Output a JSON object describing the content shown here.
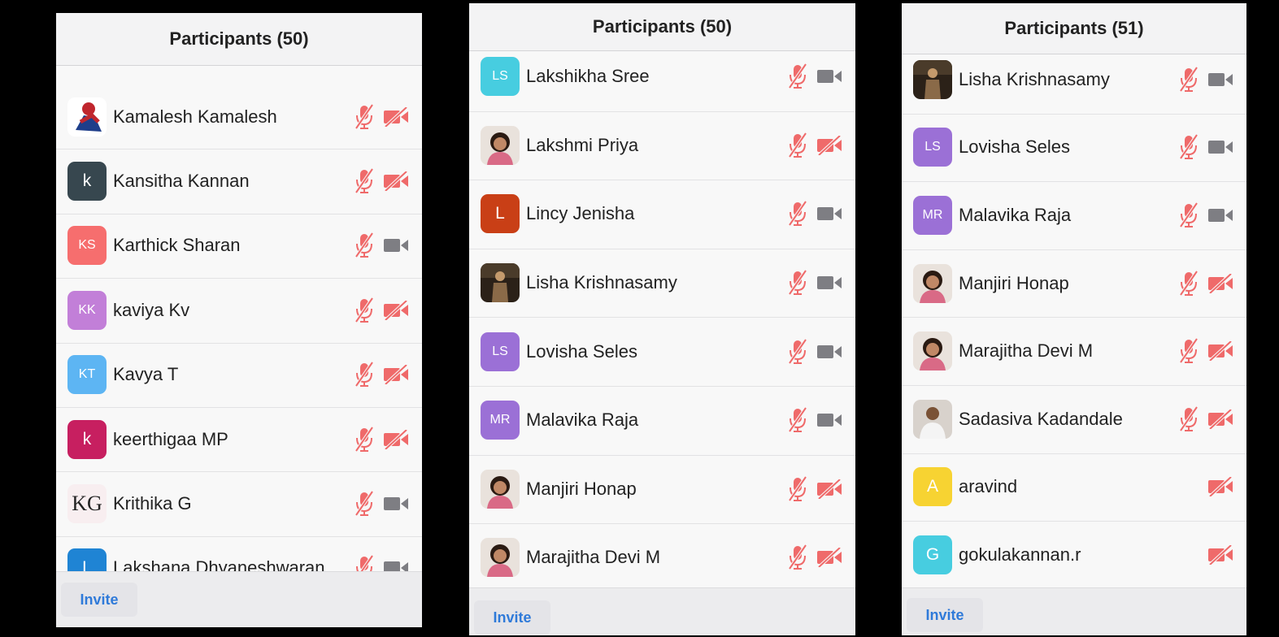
{
  "colors": {
    "muted": "#ef6a6a",
    "video_on": "#7e7e83",
    "link": "#2f7ad9"
  },
  "panels": [
    {
      "title": "Participants (50)",
      "invite_label": "Invite",
      "participants": [
        {
          "name": "Kamalesh Kamalesh",
          "avatar_type": "photo",
          "avatar_icon": "spiderman-photo",
          "mic": "muted",
          "video": "off"
        },
        {
          "name": "Kansitha Kannan",
          "initials": "k",
          "avatar_color": "#37474f",
          "mic": "muted",
          "video": "off"
        },
        {
          "name": "Karthick Sharan",
          "initials": "KS",
          "avatar_color": "#f66e6e",
          "mic": "muted",
          "video": "on"
        },
        {
          "name": "kaviya Kv",
          "initials": "KK",
          "avatar_color": "#c27fd8",
          "mic": "muted",
          "video": "off"
        },
        {
          "name": "Kavya T",
          "initials": "KT",
          "avatar_color": "#5db5f3",
          "mic": "muted",
          "video": "off"
        },
        {
          "name": "keerthigaa MP",
          "initials": "k",
          "avatar_color": "#c71f60",
          "mic": "muted",
          "video": "off"
        },
        {
          "name": "Krithika G",
          "avatar_type": "logo",
          "logo_text": "KG",
          "mic": "muted",
          "video": "on"
        },
        {
          "name": "Lakshana Dhyaneshwaran",
          "initials": "L",
          "avatar_color": "#1f84d4",
          "mic": "muted",
          "video": "on"
        }
      ]
    },
    {
      "title": "Participants (50)",
      "invite_label": "Invite",
      "participants": [
        {
          "name": "Lakshikha Sree",
          "initials": "LS",
          "avatar_color": "#47cde0",
          "mic": "muted",
          "video": "on"
        },
        {
          "name": "Lakshmi Priya",
          "avatar_type": "photo",
          "avatar_icon": "woman-photo",
          "mic": "muted",
          "video": "off"
        },
        {
          "name": "Lincy Jenisha",
          "initials": "L",
          "avatar_color": "#c93f16",
          "mic": "muted",
          "video": "on"
        },
        {
          "name": "Lisha Krishnasamy",
          "avatar_type": "photo",
          "avatar_icon": "warrior-photo",
          "mic": "muted",
          "video": "on"
        },
        {
          "name": "Lovisha Seles",
          "initials": "LS",
          "avatar_color": "#9b70d6",
          "mic": "muted",
          "video": "on"
        },
        {
          "name": "Malavika Raja",
          "initials": "MR",
          "avatar_color": "#9b70d6",
          "mic": "muted",
          "video": "on"
        },
        {
          "name": "Manjiri Honap",
          "avatar_type": "photo",
          "avatar_icon": "woman-photo",
          "mic": "muted",
          "video": "off"
        },
        {
          "name": "Marajitha Devi M",
          "avatar_type": "photo",
          "avatar_icon": "woman-photo",
          "mic": "muted",
          "video": "off"
        }
      ]
    },
    {
      "title": "Participants (51)",
      "invite_label": "Invite",
      "participants": [
        {
          "name": "Lisha Krishnasamy",
          "avatar_type": "photo",
          "avatar_icon": "warrior-photo",
          "mic": "muted",
          "video": "on"
        },
        {
          "name": "Lovisha Seles",
          "initials": "LS",
          "avatar_color": "#9b70d6",
          "mic": "muted",
          "video": "on"
        },
        {
          "name": "Malavika Raja",
          "initials": "MR",
          "avatar_color": "#9b70d6",
          "mic": "muted",
          "video": "on"
        },
        {
          "name": "Manjiri Honap",
          "avatar_type": "photo",
          "avatar_icon": "woman-photo",
          "mic": "muted",
          "video": "off"
        },
        {
          "name": "Marajitha Devi M",
          "avatar_type": "photo",
          "avatar_icon": "woman-photo",
          "mic": "muted",
          "video": "off"
        },
        {
          "name": "Sadasiva Kadandale",
          "avatar_type": "photo",
          "avatar_icon": "man-photo",
          "mic": "muted",
          "video": "off"
        },
        {
          "name": "aravind",
          "initials": "A",
          "avatar_color": "#f7d332",
          "mic": "none",
          "video": "off"
        },
        {
          "name": "gokulakannan.r",
          "initials": "G",
          "avatar_color": "#47cde0",
          "mic": "none",
          "video": "off"
        }
      ]
    }
  ]
}
